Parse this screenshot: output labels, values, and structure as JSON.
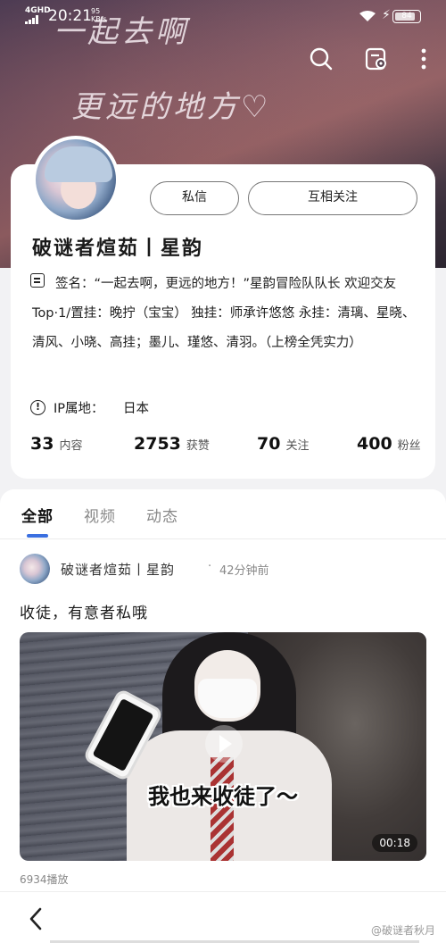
{
  "status_bar": {
    "network": "4GHD",
    "time": "20:21",
    "speed_value": "95",
    "speed_unit": "KB/s",
    "battery": "84"
  },
  "header": {
    "bg_text_line1": "一起去啊",
    "bg_text_line2": "更远的地方♡",
    "icons": [
      "search-icon",
      "share-card-icon",
      "more-icon"
    ]
  },
  "profile": {
    "message_button": "私信",
    "follow_button": "互相关注",
    "nickname": "破谜者煊茹丨星韵",
    "signature": "签名：“一起去啊，更远的地方！”星韵冒险队队长 欢迎交友 Top·1/置挂：晚拧（宝宝） 独挂：师承许悠悠 永挂：清璃、星晓、清风、小晓、高挂；墨儿、瑾悠、清羽。（上榜全凭实力）",
    "ip_label": "IP属地：",
    "ip_value": "日本",
    "stats": [
      {
        "value": "33",
        "label": "内容"
      },
      {
        "value": "2753",
        "label": "获赞"
      },
      {
        "value": "70",
        "label": "关注"
      },
      {
        "value": "400",
        "label": "粉丝"
      }
    ]
  },
  "tabs": [
    "全部",
    "视频",
    "动态"
  ],
  "active_tab": "全部",
  "post": {
    "author": "破谜者煊茹丨星韵",
    "dot": "·",
    "time": "42分钟前",
    "text": "收徒，有意者私哦",
    "video_caption": "我也来收徒了～",
    "duration": "00:18",
    "plays": "6934播放"
  },
  "footer": {
    "watermark": "@破谜者秋月"
  },
  "colors": {
    "tab_indicator": "#3a6fe0",
    "card_bg": "#ffffff"
  }
}
